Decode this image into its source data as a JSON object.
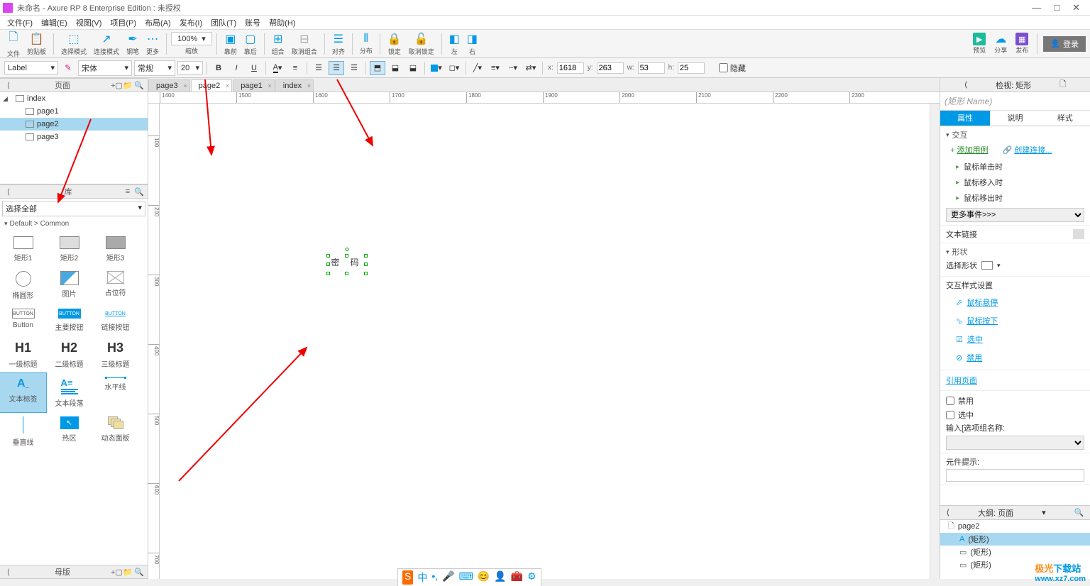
{
  "titlebar": {
    "title": "未命名 - Axure RP 8 Enterprise Edition : 未授权"
  },
  "menubar": [
    "文件(F)",
    "编辑(E)",
    "视图(V)",
    "项目(P)",
    "布局(A)",
    "发布(I)",
    "团队(T)",
    "账号",
    "帮助(H)"
  ],
  "toolbar": {
    "groups": [
      {
        "label": "文件",
        "icon": "📄"
      },
      {
        "label": "剪贴板",
        "icon": "📋"
      }
    ],
    "sel_mode": "选择模式",
    "conn_mode": "连接模式",
    "pen": "钢笔",
    "more": "更多",
    "zoom": "100%",
    "zoom_lbl": "缩放",
    "align_group": [
      "靠前",
      "靠后",
      "组合",
      "取消组合",
      "对齐",
      "分布",
      "锁定",
      "取消锁定",
      "左",
      "右"
    ],
    "right": [
      {
        "label": "预览",
        "bg": "#1abc9c"
      },
      {
        "label": "分享",
        "bg": "#0099e5"
      },
      {
        "label": "发布",
        "bg": "#7a4fd0"
      }
    ],
    "login": "登录"
  },
  "format": {
    "preset": "Label",
    "font": "宋体",
    "style": "常规",
    "size": "20",
    "x_lbl": "x:",
    "x": "1618",
    "y_lbl": "y:",
    "y": "263",
    "w_lbl": "w:",
    "w": "53",
    "h_lbl": "h:",
    "h": "25",
    "hidden": "隐藏"
  },
  "pages": {
    "header": "页面",
    "tree": [
      {
        "label": "index",
        "indent": 0,
        "arr": true
      },
      {
        "label": "page1",
        "indent": 1
      },
      {
        "label": "page2",
        "indent": 1,
        "sel": true
      },
      {
        "label": "page3",
        "indent": 1
      }
    ]
  },
  "library": {
    "header": "库",
    "select": "选择全部",
    "path": "Default > Common",
    "items": [
      {
        "label": "矩形1",
        "t": "rect"
      },
      {
        "label": "矩形2",
        "t": "rectg"
      },
      {
        "label": "矩形3",
        "t": "rectd"
      },
      {
        "label": "椭圆形",
        "t": "circle"
      },
      {
        "label": "图片",
        "t": "img"
      },
      {
        "label": "占位符",
        "t": "ph"
      },
      {
        "label": "Button",
        "t": "btn"
      },
      {
        "label": "主要按钮",
        "t": "btnp"
      },
      {
        "label": "链接按钮",
        "t": "btnl"
      },
      {
        "label": "一级标题",
        "t": "h1",
        "txt": "H1"
      },
      {
        "label": "二级标题",
        "t": "h2",
        "txt": "H2"
      },
      {
        "label": "三级标题",
        "t": "h3",
        "txt": "H3"
      },
      {
        "label": "文本标签",
        "t": "label",
        "sel": true
      },
      {
        "label": "文本段落",
        "t": "para"
      },
      {
        "label": "水平线",
        "t": "hline"
      },
      {
        "label": "垂直线",
        "t": "vline"
      },
      {
        "label": "热区",
        "t": "hot"
      },
      {
        "label": "动态面板",
        "t": "dyn"
      }
    ],
    "master_header": "母版"
  },
  "tabs": [
    {
      "label": "page3"
    },
    {
      "label": "page2",
      "active": true
    },
    {
      "label": "page1"
    },
    {
      "label": "index"
    }
  ],
  "ruler_h": [
    1400,
    1500,
    1600,
    1700,
    1800,
    1900,
    2000,
    2100,
    2200,
    2300
  ],
  "ruler_v": [
    100,
    200,
    300,
    400,
    500,
    600,
    700
  ],
  "canvas": {
    "widget_text": "密  码"
  },
  "inspector": {
    "header": "检视: 矩形",
    "name_placeholder": "(矩形 Name)",
    "tabs": [
      "属性",
      "说明",
      "样式"
    ],
    "interact_hdr": "交互",
    "add_case": "添加用例",
    "create_link": "创建连接...",
    "events": [
      "鼠标单击时",
      "鼠标移入时",
      "鼠标移出时"
    ],
    "more_events": "更多事件>>>",
    "text_link_lbl": "文本链接",
    "shape_hdr": "形状",
    "shape_sel_lbl": "选择形状",
    "style_hdr": "交互样式设置",
    "styles": [
      "鼠标悬停",
      "鼠标按下",
      "选中",
      "禁用"
    ],
    "ref_page": "引用页面",
    "disabled": "禁用",
    "selected": "选中",
    "group_lbl": "输入[选项组名称:",
    "tooltip_lbl": "元件提示:"
  },
  "outline": {
    "header": "大纲: 页面",
    "items": [
      {
        "label": "page2",
        "t": "page"
      },
      {
        "label": "(矩形)",
        "t": "label",
        "sel": true
      },
      {
        "label": "(矩形)",
        "t": "rect"
      },
      {
        "label": "(矩形)",
        "t": "rect"
      }
    ]
  }
}
